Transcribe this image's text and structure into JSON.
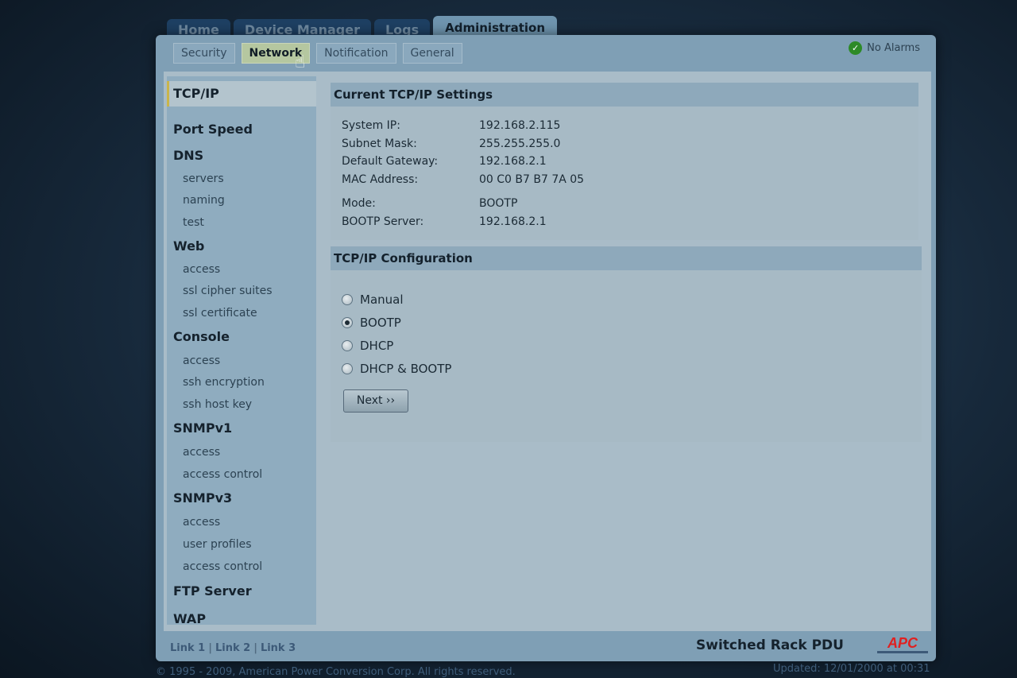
{
  "main_tabs": [
    {
      "label": "Home",
      "active": false
    },
    {
      "label": "Device Manager",
      "active": false
    },
    {
      "label": "Logs",
      "active": false
    },
    {
      "label": "Administration",
      "active": true
    }
  ],
  "sub_tabs": [
    {
      "label": "Security",
      "active": false
    },
    {
      "label": "Network",
      "active": true
    },
    {
      "label": "Notification",
      "active": false
    },
    {
      "label": "General",
      "active": false
    }
  ],
  "alarm_status": "No Alarms",
  "sidebar": {
    "tcpip": "TCP/IP",
    "port_speed": "Port Speed",
    "dns": {
      "label": "DNS",
      "items": [
        "servers",
        "naming",
        "test"
      ]
    },
    "web": {
      "label": "Web",
      "items": [
        "access",
        "ssl cipher suites",
        "ssl certificate"
      ]
    },
    "console": {
      "label": "Console",
      "items": [
        "access",
        "ssh encryption",
        "ssh host key"
      ]
    },
    "snmpv1": {
      "label": "SNMPv1",
      "items": [
        "access",
        "access control"
      ]
    },
    "snmpv3": {
      "label": "SNMPv3",
      "items": [
        "access",
        "user profiles",
        "access control"
      ]
    },
    "ftp_server": "FTP Server",
    "wap": "WAP"
  },
  "current_settings": {
    "title": "Current TCP/IP Settings",
    "rows": [
      {
        "label": "System IP:",
        "value": "192.168.2.115"
      },
      {
        "label": "Subnet Mask:",
        "value": "255.255.255.0"
      },
      {
        "label": "Default Gateway:",
        "value": "192.168.2.1"
      },
      {
        "label": "MAC Address:",
        "value": "00 C0 B7 B7 7A 05"
      },
      {
        "label": "Mode:",
        "value": "BOOTP"
      },
      {
        "label": "BOOTP Server:",
        "value": "192.168.2.1"
      }
    ]
  },
  "configuration": {
    "title": "TCP/IP Configuration",
    "options": [
      {
        "label": "Manual",
        "selected": false
      },
      {
        "label": "BOOTP",
        "selected": true
      },
      {
        "label": "DHCP",
        "selected": false
      },
      {
        "label": "DHCP & BOOTP",
        "selected": false
      }
    ],
    "next_label": "Next ››"
  },
  "footer": {
    "links": [
      "Link 1",
      "Link 2",
      "Link 3"
    ],
    "product": "Switched Rack PDU",
    "logo_text": "APC",
    "copyright": "© 1995 - 2009, American Power Conversion Corp. All rights reserved.",
    "updated": "Updated: 12/01/2000 at 00:31"
  },
  "colors": {
    "logo_red": "#e02020",
    "alarm_ok": "#2d8a27",
    "active_subtab": "#b5c7a0"
  }
}
